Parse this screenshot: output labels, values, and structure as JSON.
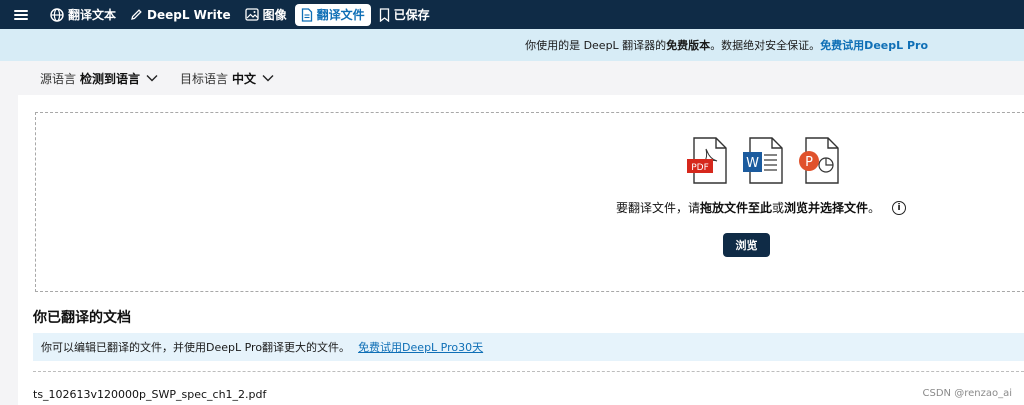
{
  "nav": {
    "items": [
      {
        "label": "翻译文本",
        "icon": "globe-icon"
      },
      {
        "label": "DeepL Write",
        "icon": "pen-icon"
      },
      {
        "label": "图像",
        "icon": "image-icon"
      },
      {
        "label": "翻译文件",
        "icon": "document-icon",
        "active": true
      },
      {
        "label": "已保存",
        "icon": "bookmark-icon"
      }
    ]
  },
  "banner": {
    "text_prefix": "你使用的是 DeepL 翻译器的",
    "text_bold": "免费版本",
    "text_suffix": "。数据绝对安全保证。",
    "link": "免费试用DeepL Pro"
  },
  "languages": {
    "source_label": "源语言",
    "source_value": "检测到语言",
    "target_label": "目标语言",
    "target_value": "中文"
  },
  "dropzone": {
    "file_types": [
      "PDF",
      "W",
      "P"
    ],
    "text_prefix": "要翻译文件，请",
    "text_bold1": "拖放文件至此",
    "text_mid": "或",
    "text_bold2": "浏览并选择文件",
    "text_end": "。",
    "browse_label": "浏览"
  },
  "documents": {
    "title": "你已翻译的文档",
    "info_text": "你可以编辑已翻译的文件，并使用DeepL Pro翻译更大的文件。",
    "info_link": "免费试用DeepL Pro30天",
    "files": [
      {
        "name": "ts_102613v120000p_SWP_spec_ch1_2.pdf"
      }
    ]
  },
  "watermark": "CSDN @renzao_ai",
  "colors": {
    "nav_bg": "#0f2b46",
    "accent": "#0f6fb6",
    "banner_bg": "#d7ecf6",
    "pdf_red": "#d6281c",
    "word_blue": "#1b5b9e",
    "ppt_orange": "#e0522c"
  }
}
